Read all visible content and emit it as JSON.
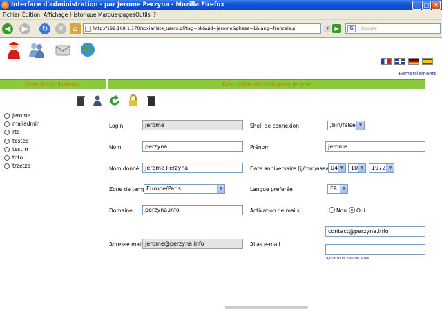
{
  "window": {
    "title": "Interface d'administration - par Jerome Perzyna - Mozilla Firefox"
  },
  "menu": {
    "items": [
      "Fichier",
      "Édition",
      "Affichage",
      "Historique",
      "Marque-pages",
      "Outils",
      "?"
    ]
  },
  "navbar": {
    "url": "http://192.168.1.170/soxia/liste_users.pl?tag=ok&uid=jerome&phase=1&lang=francais.pl",
    "search_placeholder": "Google"
  },
  "header": {
    "thanks_link": "Remerciements"
  },
  "left_panel": {
    "title": "Liste des utilisateurs",
    "users": [
      "jerome",
      "mailadmin",
      "rte",
      "tested",
      "testrrr",
      "toto",
      "trzetze"
    ]
  },
  "right_panel": {
    "title": "Description de l'utilisateur jerome"
  },
  "form": {
    "login_label": "Login",
    "login_value": "jerome",
    "shell_label": "Shell de connexion",
    "shell_value": "/bin/false",
    "nom_label": "Nom",
    "nom_value": "perzyna",
    "prenom_label": "Prénom",
    "prenom_value": "jerome",
    "nom_donne_label": "Nom donné",
    "nom_donne_value": "Jerome Perzyna",
    "birthday_label": "Date anniversaire (jj/mm/aaaa)",
    "birth_day": "04",
    "birth_month": "10",
    "birth_year": "1972",
    "timezone_label": "Zone de temps",
    "timezone_value": "Europe/Paris",
    "language_label": "Langue preferée",
    "language_value": "FR",
    "domain_label": "Domaine",
    "domain_value": "perzyna.info",
    "mail_activation_label": "Activation de mails",
    "mail_off_label": "Non",
    "mail_on_label": "Oui",
    "email_label": "Adresse mail",
    "email_value": "jerome@perzyna.info",
    "alias_label": "Alias e-mail",
    "alias_value": "contact@perzyna.info",
    "alias_value_2": "",
    "add_alias_link": "ajout d'un nouvel alias"
  },
  "colors": {
    "panel_bar": "#8dc63f",
    "panel_text": "#c87a00",
    "link": "#1a2f9c"
  }
}
